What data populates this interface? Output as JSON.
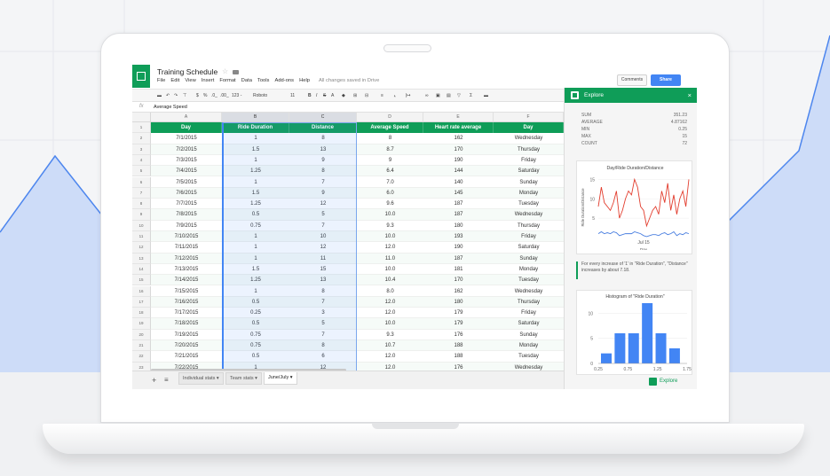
{
  "doc": {
    "title": "Training Schedule",
    "menus": [
      "File",
      "Edit",
      "View",
      "Insert",
      "Format",
      "Data",
      "Tools",
      "Add-ons",
      "Help"
    ],
    "saved_status": "All changes saved in Drive",
    "comments_label": "Comments",
    "share_label": "Share"
  },
  "toolbar": {
    "currency": "$",
    "percent": "%",
    "dec_less": ".0_",
    "dec_more": ".00_",
    "format_123": "123 -",
    "font": "Roboto",
    "font_size": "11",
    "bold": "B",
    "italic": "I",
    "strike": "S",
    "textcolor": "A"
  },
  "formula_bar": {
    "fx": "fx",
    "value": "Average Speed"
  },
  "sheet": {
    "col_letters": [
      "A",
      "B",
      "C",
      "D",
      "E",
      "F"
    ],
    "headers": [
      "Day",
      "Ride Duration",
      "Distance",
      "Average Speed",
      "Heart rate average",
      "Day"
    ],
    "rows": [
      [
        "7/1/2015",
        "1",
        "8",
        "8",
        "162",
        "Wednesday"
      ],
      [
        "7/2/2015",
        "1.5",
        "13",
        "8.7",
        "170",
        "Thursday"
      ],
      [
        "7/3/2015",
        "1",
        "9",
        "9",
        "190",
        "Friday"
      ],
      [
        "7/4/2015",
        "1.25",
        "8",
        "6.4",
        "144",
        "Saturday"
      ],
      [
        "7/5/2015",
        "1",
        "7",
        "7.0",
        "140",
        "Sunday"
      ],
      [
        "7/6/2015",
        "1.5",
        "9",
        "6.0",
        "145",
        "Monday"
      ],
      [
        "7/7/2015",
        "1.25",
        "12",
        "9.6",
        "187",
        "Tuesday"
      ],
      [
        "7/8/2015",
        "0.5",
        "5",
        "10.0",
        "187",
        "Wednesday"
      ],
      [
        "7/9/2015",
        "0.75",
        "7",
        "9.3",
        "180",
        "Thursday"
      ],
      [
        "7/10/2015",
        "1",
        "10",
        "10.0",
        "193",
        "Friday"
      ],
      [
        "7/11/2015",
        "1",
        "12",
        "12.0",
        "190",
        "Saturday"
      ],
      [
        "7/12/2015",
        "1",
        "11",
        "11.0",
        "187",
        "Sunday"
      ],
      [
        "7/13/2015",
        "1.5",
        "15",
        "10.0",
        "181",
        "Monday"
      ],
      [
        "7/14/2015",
        "1.25",
        "13",
        "10.4",
        "170",
        "Tuesday"
      ],
      [
        "7/15/2015",
        "1",
        "8",
        "8.0",
        "162",
        "Wednesday"
      ],
      [
        "7/16/2015",
        "0.5",
        "7",
        "12.0",
        "180",
        "Thursday"
      ],
      [
        "7/17/2015",
        "0.25",
        "3",
        "12.0",
        "179",
        "Friday"
      ],
      [
        "7/18/2015",
        "0.5",
        "5",
        "10.0",
        "179",
        "Saturday"
      ],
      [
        "7/19/2015",
        "0.75",
        "7",
        "9.3",
        "176",
        "Sunday"
      ],
      [
        "7/20/2015",
        "0.75",
        "8",
        "10.7",
        "188",
        "Monday"
      ],
      [
        "7/21/2015",
        "0.5",
        "6",
        "12.0",
        "188",
        "Tuesday"
      ],
      [
        "7/22/2015",
        "1",
        "12",
        "12.0",
        "176",
        "Wednesday"
      ]
    ],
    "tabs": [
      "Individual stats",
      "Team stats",
      "June/July"
    ],
    "active_tab": "June/July"
  },
  "explore": {
    "title": "Explore",
    "close": "×",
    "stats": [
      {
        "label": "SUM",
        "value": "351.23"
      },
      {
        "label": "AVERAGE",
        "value": "4.87162"
      },
      {
        "label": "MIN",
        "value": "0.25"
      },
      {
        "label": "MAX",
        "value": "15"
      },
      {
        "label": "COUNT",
        "value": "72"
      }
    ],
    "insight": "For every increase of '1' in \"Ride Duration\", \"Distance\" increases by about 7.18.",
    "button": "Explore"
  },
  "chart_data": [
    {
      "type": "line",
      "title": "Day/Ride Duration/Distance",
      "xlabel": "Day",
      "ylabel": "Ride Duration/Distance",
      "x_tick": "Jul 15",
      "yticks": [
        5,
        10,
        15
      ],
      "series": [
        {
          "values": [
            8,
            13,
            9,
            8,
            7,
            9,
            12,
            5,
            7,
            10,
            12,
            11,
            15,
            13,
            8,
            7,
            3,
            5,
            7,
            8,
            6,
            12,
            9,
            14,
            7,
            11,
            6,
            10,
            12,
            8,
            15
          ],
          "color": "#e23d2e"
        },
        {
          "values": [
            1,
            1.5,
            1,
            1.25,
            1,
            1.5,
            1.25,
            0.5,
            0.75,
            1,
            1,
            1,
            1.5,
            1.25,
            1,
            0.5,
            0.25,
            0.5,
            0.75,
            0.75,
            0.5,
            1,
            1.25,
            0.75,
            1,
            1.5,
            0.5,
            1,
            0.75,
            1.25,
            1
          ],
          "color": "#4a7fe0"
        }
      ]
    },
    {
      "type": "bar",
      "title": "Histogram of \"Ride Duration\"",
      "categories": [
        "0.25",
        "0.5",
        "0.75",
        "1",
        "1.25",
        "1.5"
      ],
      "x_ticks": [
        "0.25",
        "0.75",
        "1.25",
        "1.75"
      ],
      "values": [
        2,
        6,
        6,
        12,
        6,
        3
      ],
      "yticks": [
        0,
        5,
        10
      ],
      "ylim": [
        0,
        12
      ],
      "color": "#4285f4"
    }
  ]
}
